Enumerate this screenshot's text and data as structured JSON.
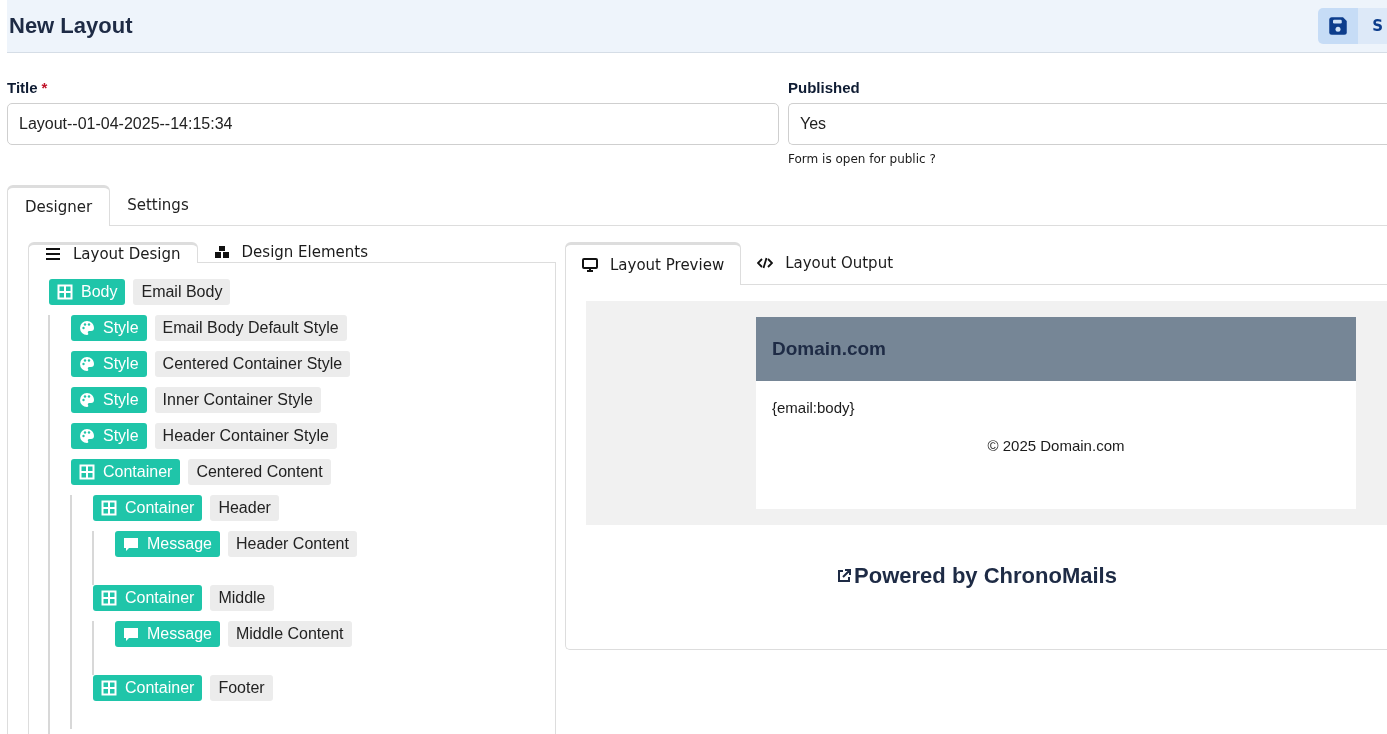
{
  "page": {
    "title": "New Layout"
  },
  "toolbar": [
    {
      "kind": "save"
    },
    {
      "kind": "text",
      "label": "S"
    }
  ],
  "fields": [
    {
      "label": "Title",
      "required_mark": "*",
      "value": "Layout--01-04-2025--14:15:34"
    },
    {
      "label": "Published",
      "value": "Yes",
      "help": "Form is open for public ?"
    }
  ],
  "tabs": [
    {
      "label": "Designer",
      "selected": true
    },
    {
      "label": "Settings",
      "selected": false
    }
  ],
  "left_tabs": [
    {
      "label": "Layout Design",
      "kind": "design",
      "selected": true
    },
    {
      "label": "Design Elements",
      "kind": "elements",
      "selected": false
    }
  ],
  "tree": [
    {
      "kind": "grid",
      "type": "Body",
      "name": "Email Body",
      "children": [
        {
          "kind": "palette",
          "type": "Style",
          "name": "Email Body Default Style"
        },
        {
          "kind": "palette",
          "type": "Style",
          "name": "Centered Container Style"
        },
        {
          "kind": "palette",
          "type": "Style",
          "name": "Inner Container Style"
        },
        {
          "kind": "palette",
          "type": "Style",
          "name": "Header Container Style"
        },
        {
          "kind": "grid",
          "type": "Container",
          "name": "Centered Content",
          "children": [
            {
              "kind": "grid",
              "type": "Container",
              "name": "Header",
              "children": [
                {
                  "kind": "message",
                  "type": "Message",
                  "name": "Header Content"
                }
              ]
            },
            {
              "kind": "grid",
              "type": "Container",
              "name": "Middle",
              "children": [
                {
                  "kind": "message",
                  "type": "Message",
                  "name": "Middle Content"
                }
              ]
            },
            {
              "kind": "grid",
              "type": "Container",
              "name": "Footer"
            }
          ]
        }
      ]
    }
  ],
  "right_tabs": [
    {
      "label": "Layout Preview",
      "kind": "preview",
      "selected": true
    },
    {
      "label": "Layout Output",
      "kind": "output",
      "selected": false
    }
  ],
  "preview": {
    "brand": "Domain.com",
    "body": "{email:body}",
    "footer": "© 2025 Domain.com",
    "powered_by": "Powered by ChronoMails"
  }
}
